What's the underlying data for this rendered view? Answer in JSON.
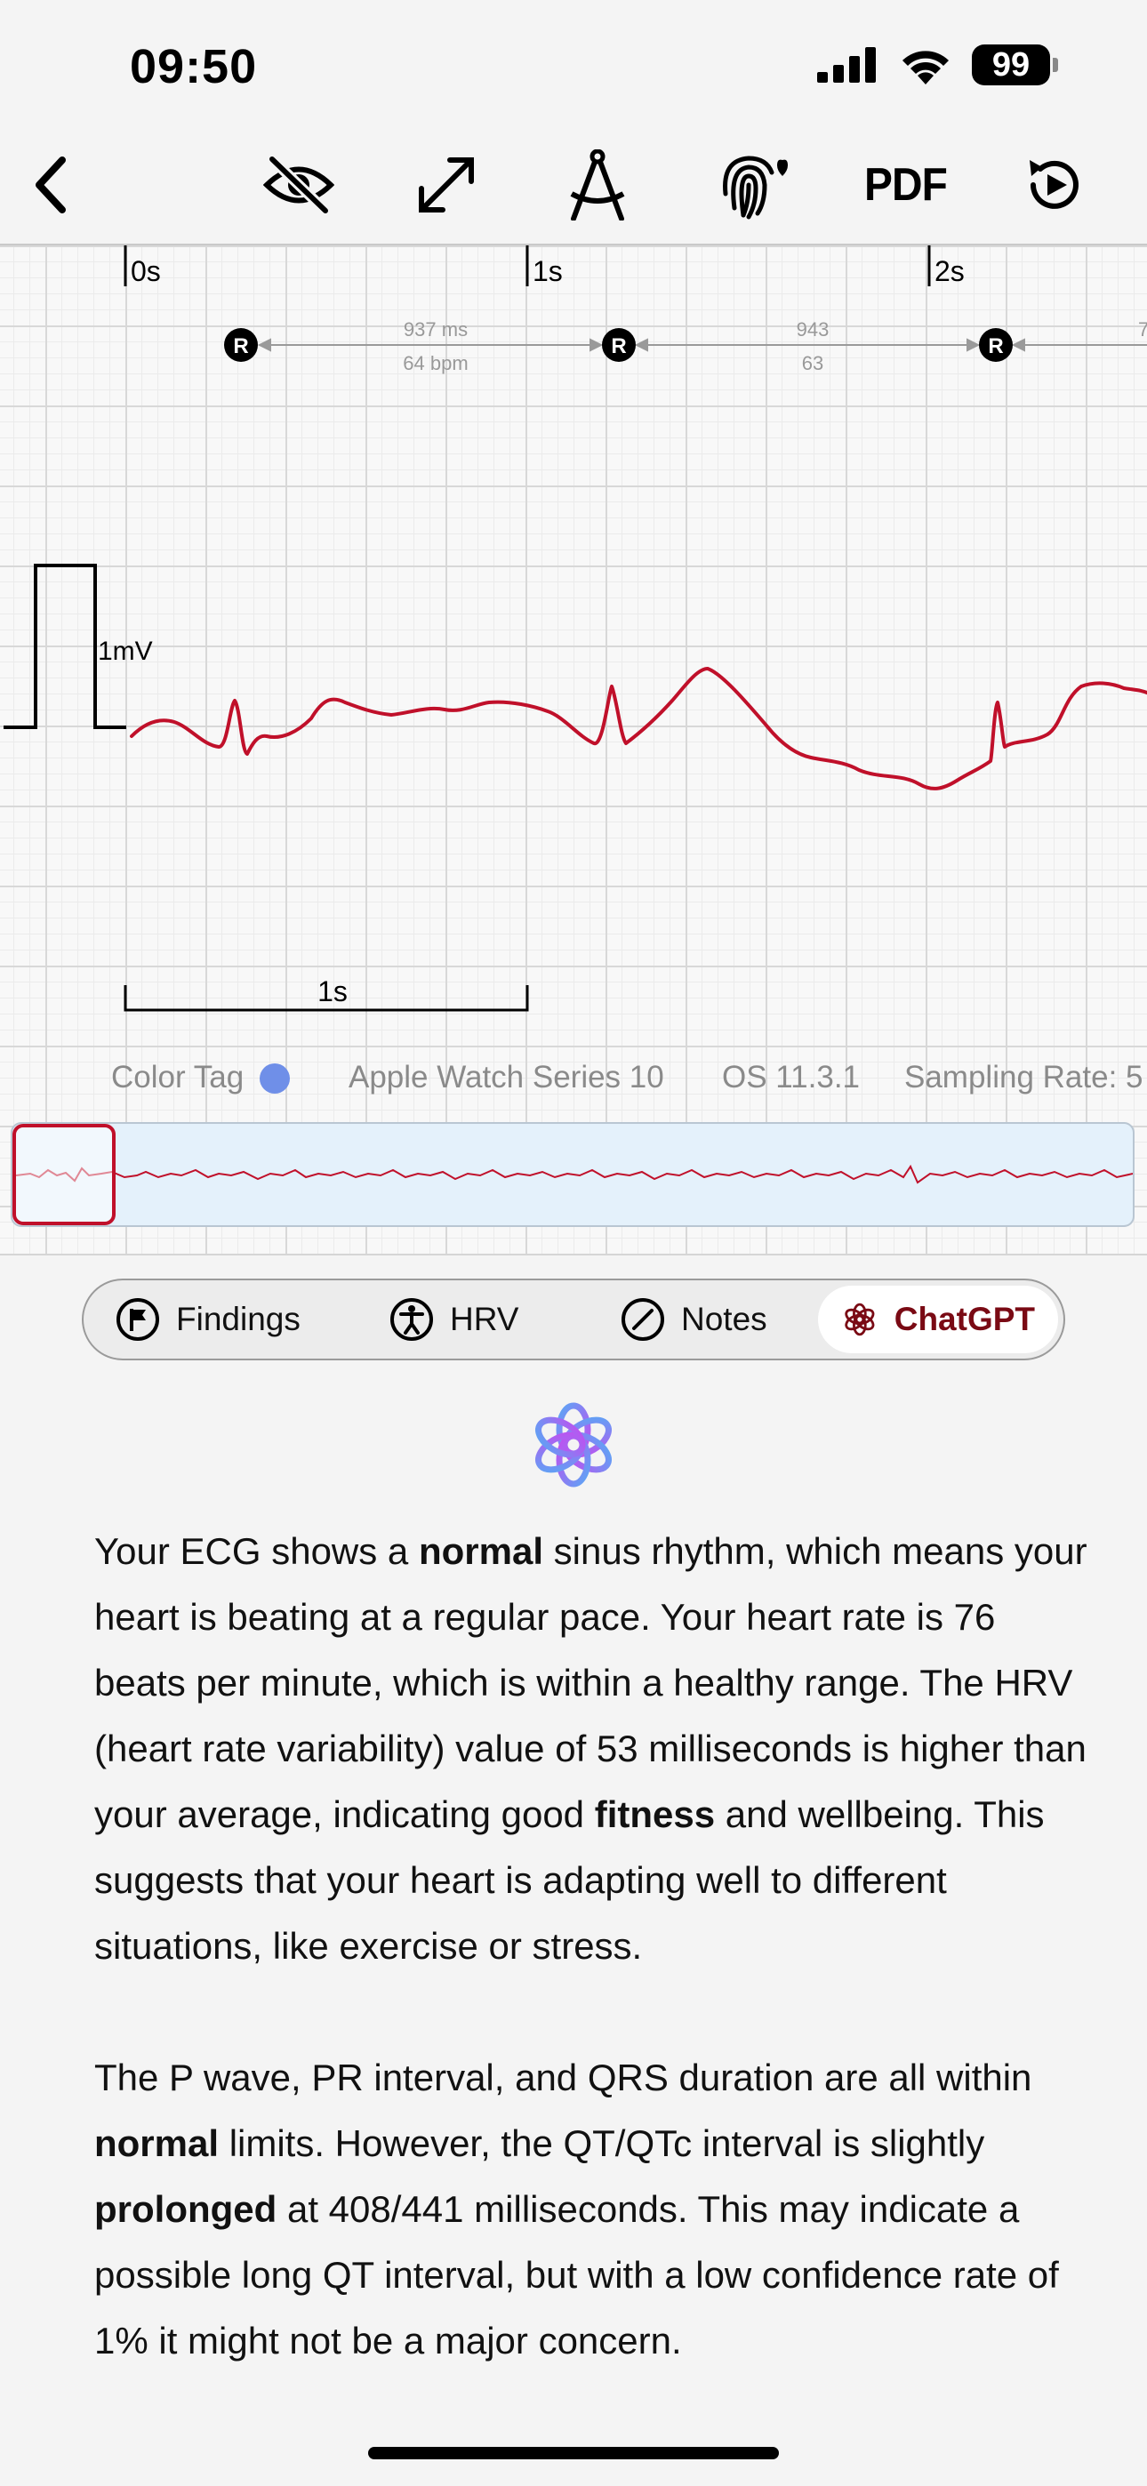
{
  "status_bar": {
    "time": "09:50",
    "battery": "99"
  },
  "toolbar": {
    "pdf_label": "PDF"
  },
  "ecg": {
    "time_markers": [
      "0s",
      "1s",
      "2s"
    ],
    "r_label": "R",
    "intervals": [
      {
        "ms": "937 ms",
        "bpm": "64 bpm"
      },
      {
        "ms": "943",
        "bpm": "63"
      },
      {
        "ms": "7"
      }
    ],
    "calibration_label": "1mV",
    "scale_label": "1s",
    "trace_color": "#c0102a"
  },
  "meta": {
    "color_tag_label": "Color Tag",
    "color_tag_color": "#6f8fe8",
    "device": "Apple Watch Series 10",
    "os": "OS 11.3.1",
    "sampling": "Sampling Rate: 5"
  },
  "tabs": [
    {
      "label": "Findings",
      "icon": "flag-icon"
    },
    {
      "label": "HRV",
      "icon": "figure-icon"
    },
    {
      "label": "Notes",
      "icon": "pencil-circle-icon"
    },
    {
      "label": "ChatGPT",
      "icon": "chatgpt-icon",
      "active": true
    }
  ],
  "response": {
    "p1": [
      {
        "t": "Your ECG shows a "
      },
      {
        "t": "normal",
        "b": true
      },
      {
        "t": " sinus rhythm, which means your heart is beating at a regular pace. Your heart rate is 76 beats per minute, which is within a healthy range. The HRV (heart rate variability) value of 53 milliseconds is higher than your average, indicating good "
      },
      {
        "t": "fitness",
        "b": true
      },
      {
        "t": " and wellbeing. This suggests that your heart is adapting well to different situations, like exercise or stress."
      }
    ],
    "p2": [
      {
        "t": "The P wave, PR interval, and QRS duration are all within "
      },
      {
        "t": "normal",
        "b": true
      },
      {
        "t": " limits. However, the QT/QTc interval is slightly "
      },
      {
        "t": "prolonged",
        "b": true
      },
      {
        "t": " at 408/441 milliseconds. This may indicate a possible long QT interval, but with a low confidence rate of 1% it might not be a major concern."
      }
    ]
  }
}
